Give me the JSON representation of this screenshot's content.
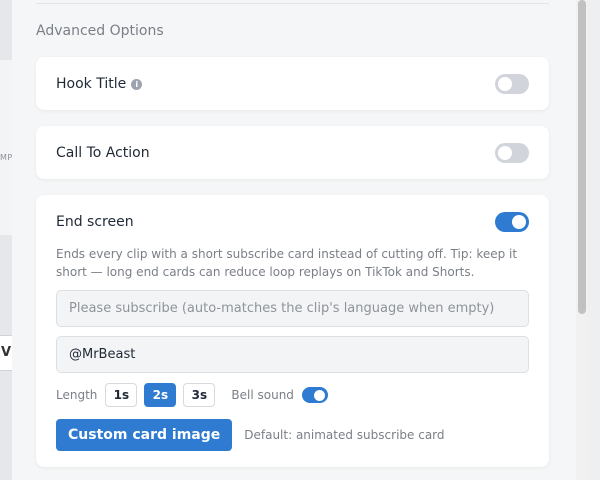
{
  "background": {
    "fragment_text": "MP",
    "fragment_text_2": "V"
  },
  "advanced": {
    "title": "Advanced Options"
  },
  "hook_title": {
    "label": "Hook Title",
    "info_glyph": "i",
    "enabled": false
  },
  "call_to_action": {
    "label": "Call To Action",
    "enabled": false
  },
  "end_screen": {
    "label": "End screen",
    "enabled": true,
    "description": "Ends every clip with a short subscribe card instead of cutting off. Tip: keep it short — long end cards can reduce loop replays on TikTok and Shorts.",
    "subscribe_placeholder": "Please subscribe (auto-matches the clip's language when empty)",
    "subscribe_value": "",
    "handle_value": "@MrBeast",
    "length_label": "Length",
    "length_options": [
      "1s",
      "2s",
      "3s"
    ],
    "length_selected": "2s",
    "bell_label": "Bell sound",
    "bell_enabled": true,
    "custom_card_button": "Custom card image",
    "custom_card_hint": "Default: animated subscribe card"
  },
  "colors": {
    "accent": "#2e7bd1",
    "toggle_off": "#d1d5db",
    "card_bg": "#ffffff",
    "panel_bg": "#f5f6f7"
  }
}
